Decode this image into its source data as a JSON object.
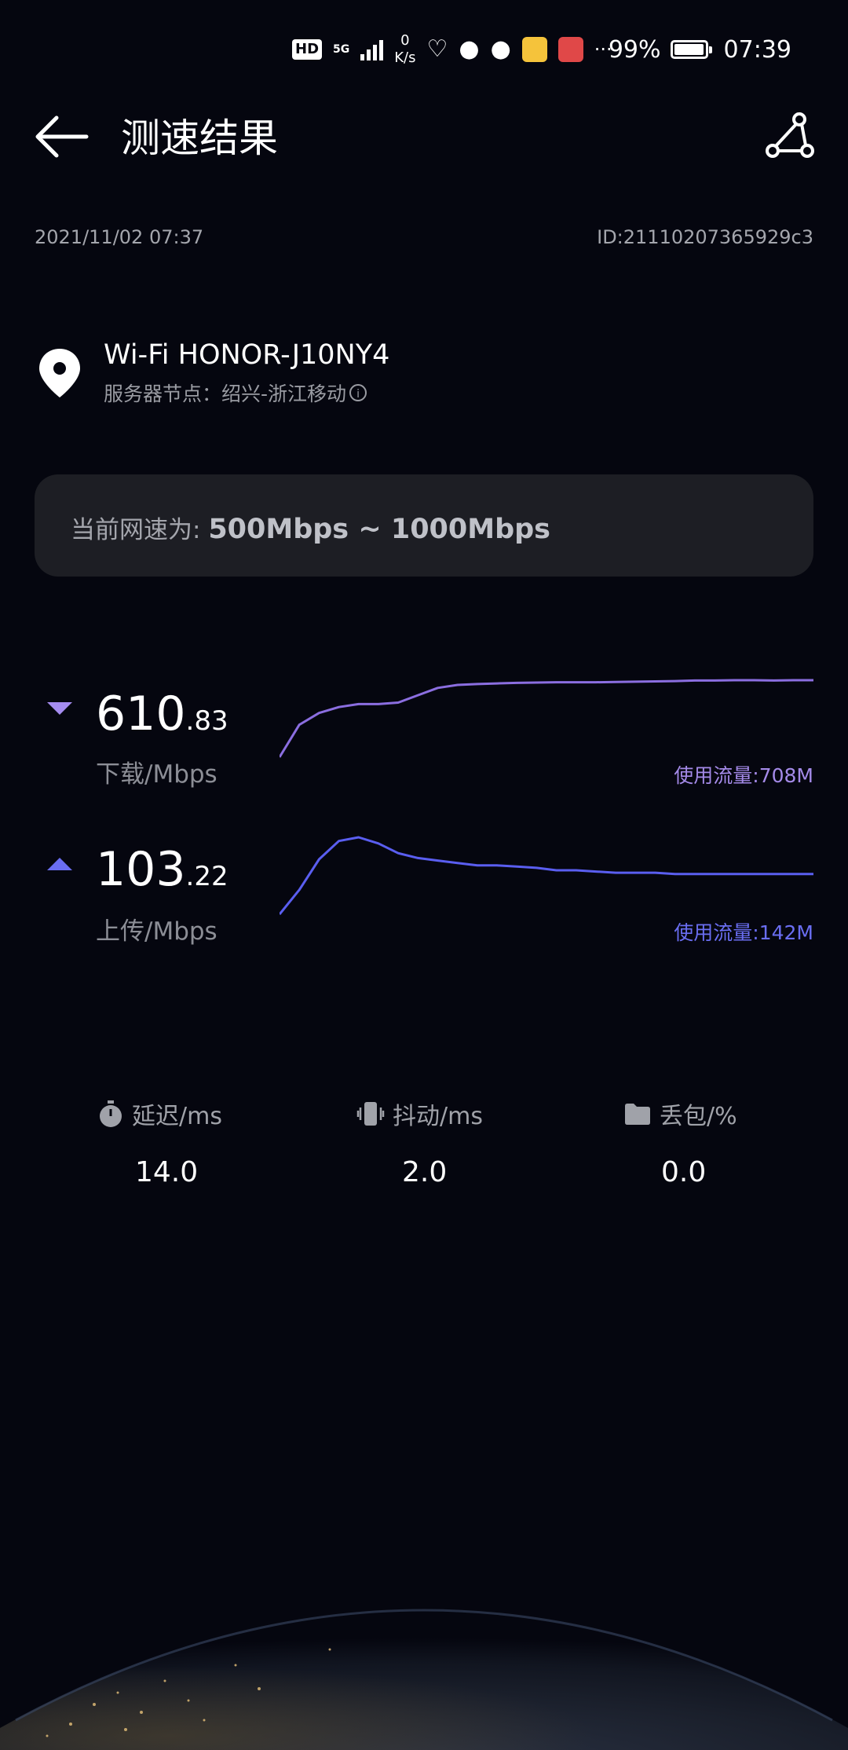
{
  "status_bar": {
    "hd": "HD",
    "network": "5G",
    "speed_value": "0",
    "speed_unit": "K/s",
    "more": "···",
    "battery_percent": "99%",
    "time": "07:39",
    "battery_level": 0.99
  },
  "header": {
    "title": "测速结果"
  },
  "meta": {
    "datetime": "2021/11/02 07:37",
    "id": "ID:21110207365929c3"
  },
  "network": {
    "ssid": "Wi-Fi HONOR-J10NY4",
    "server_node": "服务器节点：绍兴-浙江移动"
  },
  "speed_range": {
    "label": "当前网速为: ",
    "value": "500Mbps ~ 1000Mbps"
  },
  "download": {
    "value_int": "610",
    "value_dec": ".83",
    "unit": "下载/Mbps",
    "usage": "使用流量:708M",
    "color": "#8b6ee0",
    "curve": [
      350,
      460,
      500,
      520,
      530,
      530,
      535,
      560,
      585,
      595,
      598,
      600,
      602,
      603,
      604,
      604,
      604,
      605,
      606,
      607,
      608,
      610,
      610,
      611,
      611,
      610,
      611,
      611
    ]
  },
  "upload": {
    "value_int": "103",
    "value_dec": ".22",
    "unit": "上传/Mbps",
    "usage": "使用流量:142M",
    "color": "#5a5ef0",
    "curve": [
      70,
      90,
      115,
      130,
      133,
      128,
      120,
      116,
      114,
      112,
      110,
      110,
      109,
      108,
      106,
      106,
      105,
      104,
      104,
      104,
      103,
      103,
      103,
      103,
      103,
      103,
      103,
      103
    ]
  },
  "stats": {
    "latency": {
      "label": "延迟/ms",
      "value": "14.0"
    },
    "jitter": {
      "label": "抖动/ms",
      "value": "2.0"
    },
    "loss": {
      "label": "丢包/%",
      "value": "0.0"
    }
  }
}
